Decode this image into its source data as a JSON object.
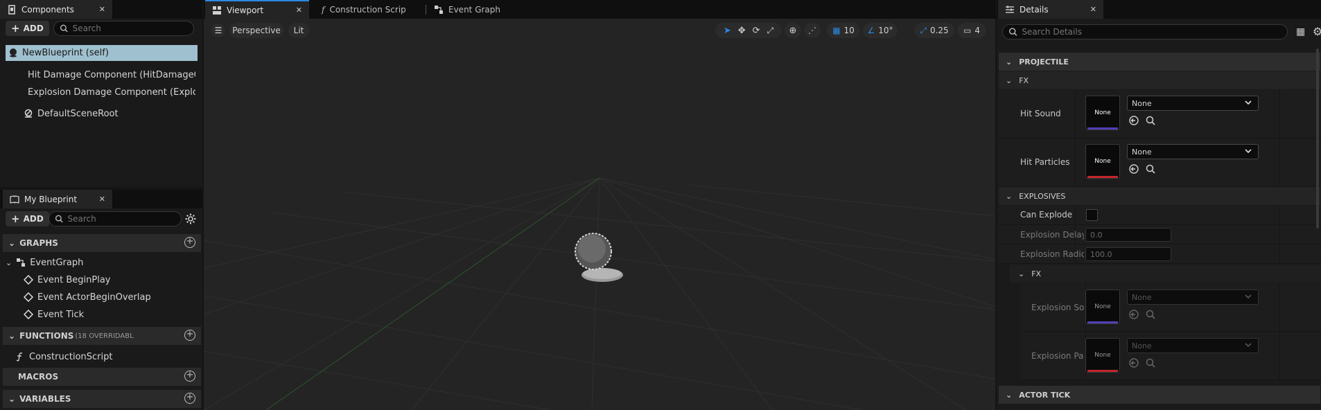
{
  "components_panel": {
    "tab_label": "Components",
    "add_label": "ADD",
    "search_placeholder": "Search",
    "items": [
      {
        "label": "NewBlueprint (self)"
      },
      {
        "label": "Hit Damage Component (HitDamageCom"
      },
      {
        "label": "Explosion Damage Component (Explosic"
      },
      {
        "label": "DefaultSceneRoot"
      }
    ]
  },
  "my_blueprint": {
    "tab_label": "My Blueprint",
    "add_label": "ADD",
    "search_placeholder": "Search",
    "graphs_label": "GRAPHS",
    "event_graph": "EventGraph",
    "events": [
      "Event BeginPlay",
      "Event ActorBeginOverlap",
      "Event Tick"
    ],
    "functions_label": "FUNCTIONS",
    "functions_note": "(18 OVERRIDABL",
    "construction_script": "ConstructionScript",
    "macros_label": "MACROS",
    "variables_label": "VARIABLES"
  },
  "editor_tabs": {
    "viewport": "Viewport",
    "construction": "Construction Scrip",
    "event_graph": "Event Graph"
  },
  "viewport": {
    "perspective": "Perspective",
    "lit": "Lit",
    "grid_snap": "10",
    "rotation_snap": "10°",
    "scale_snap": "0.25",
    "camera_speed": "4"
  },
  "details": {
    "tab_label": "Details",
    "search_placeholder": "Search Details",
    "projectile": "PROJECTILE",
    "fx": "FX",
    "hit_sound": "Hit Sound",
    "hit_particles": "Hit Particles",
    "none": "None",
    "explosives": "EXPLOSIVES",
    "can_explode": "Can Explode",
    "explosion_delay": "Explosion Delay",
    "explosion_delay_value": "0.0",
    "explosion_radius": "Explosion Radiou",
    "explosion_radius_value": "100.0",
    "fx2": "FX",
    "explosion_sound": "Explosion So",
    "explosion_particles": "Explosion Par",
    "actor_tick": "ACTOR TICK"
  },
  "colors": {
    "accent_blue": "#2b8ae6",
    "selected_row": "#9fc0cf",
    "sound_bar": "#4f3fb8",
    "particle_bar": "#c0262b"
  }
}
